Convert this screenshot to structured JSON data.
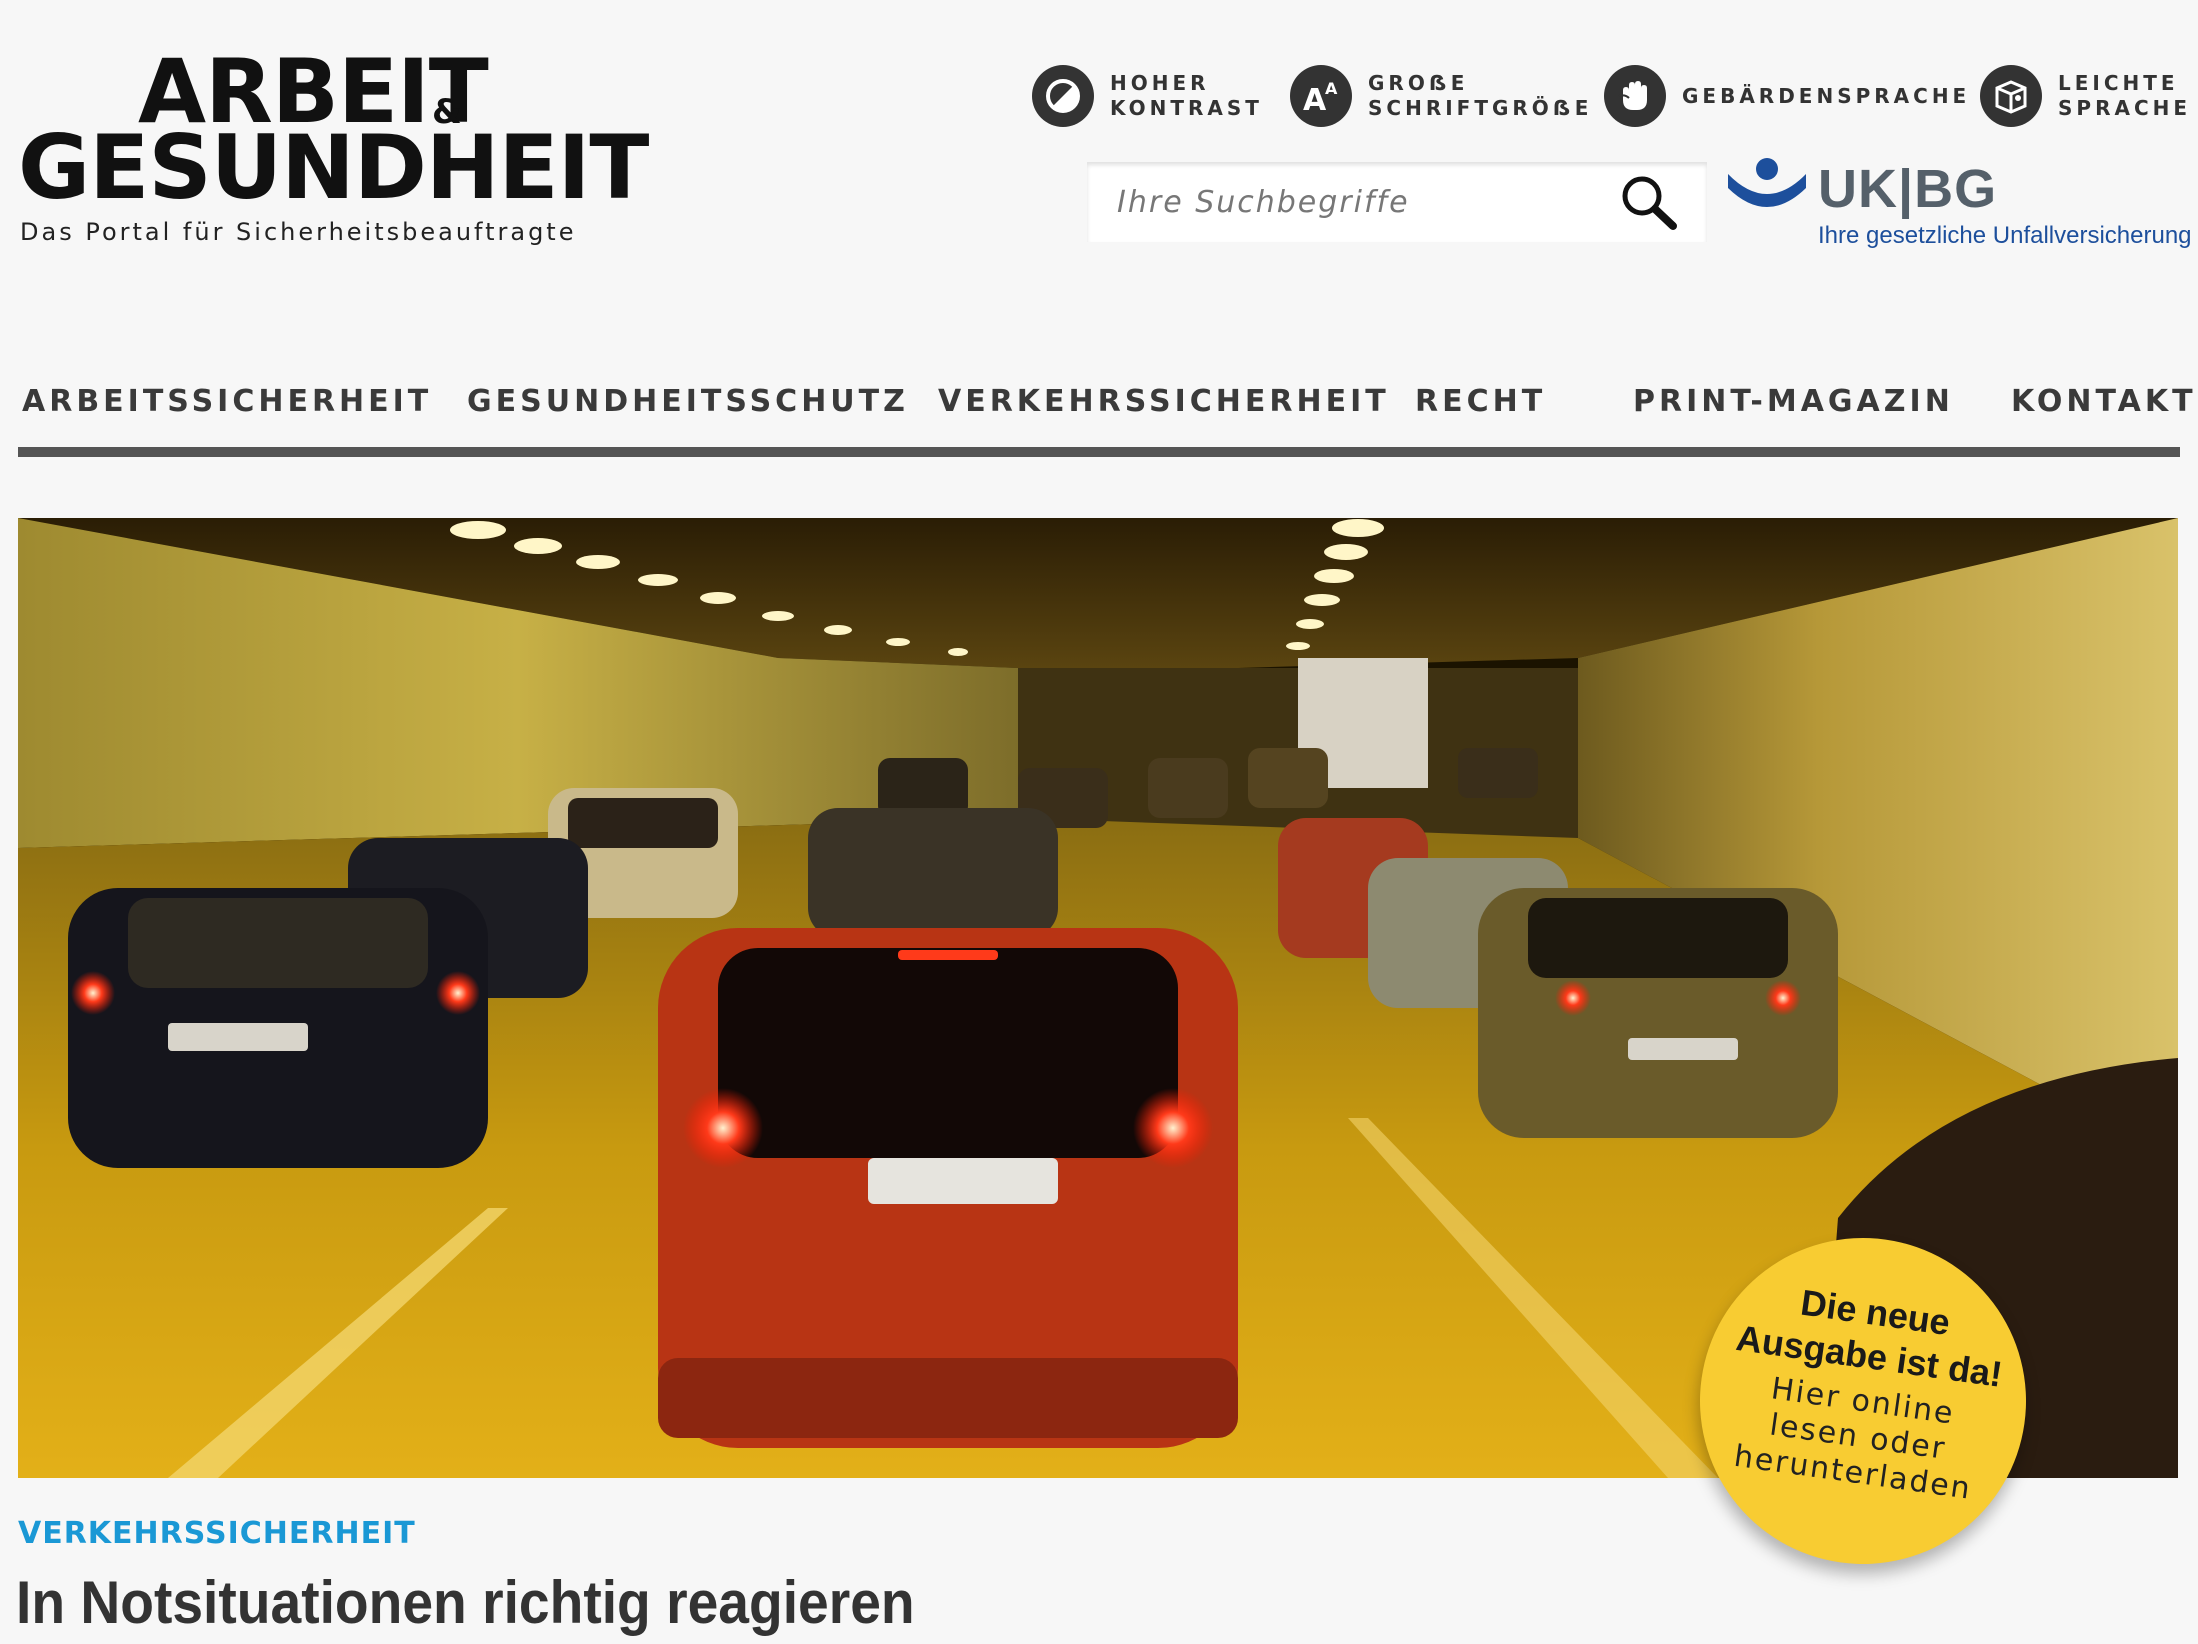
{
  "logo": {
    "line1": "ARBEIT",
    "amp": "&",
    "line2": "GESUNDHEIT",
    "tagline": "Das Portal für Sicherheitsbeauftragte"
  },
  "accessibility": [
    {
      "id": "contrast",
      "icon": "contrast-icon",
      "line1": "HOHER",
      "line2": "KONTRAST"
    },
    {
      "id": "fontsize",
      "icon": "font-size-icon",
      "line1": "GROẞE",
      "line2": "SCHRIFTGRÖẞE"
    },
    {
      "id": "sign",
      "icon": "sign-language-icon",
      "line1": "GEBÄRDENSPRACHE",
      "line2": ""
    },
    {
      "id": "easy",
      "icon": "easy-language-icon",
      "line1": "LEICHTE",
      "line2": "SPRACHE"
    }
  ],
  "search": {
    "placeholder": "Ihre Suchbegriffe",
    "icon": "search-icon"
  },
  "ukbg": {
    "name": "UK|BG",
    "subtitle": "Ihre gesetzliche Unfallversicherung",
    "color": "#1d4f9c"
  },
  "nav": [
    "ARBEITSSICHERHEIT",
    "GESUNDHEITSSCHUTZ",
    "VERKEHRSSICHERHEIT",
    "RECHT",
    "PRINT-MAGAZIN",
    "KONTAKT"
  ],
  "hero": {
    "badge": {
      "headline1": "Die neue",
      "headline2": "Ausgabe ist da!",
      "sub1": "Hier online",
      "sub2": "lesen oder",
      "sub3": "herunterladen",
      "color": "#f8cc32"
    }
  },
  "article": {
    "category": "VERKEHRSSICHERHEIT",
    "category_color": "#1a98d5",
    "title": "In Notsituationen richtig reagieren"
  }
}
